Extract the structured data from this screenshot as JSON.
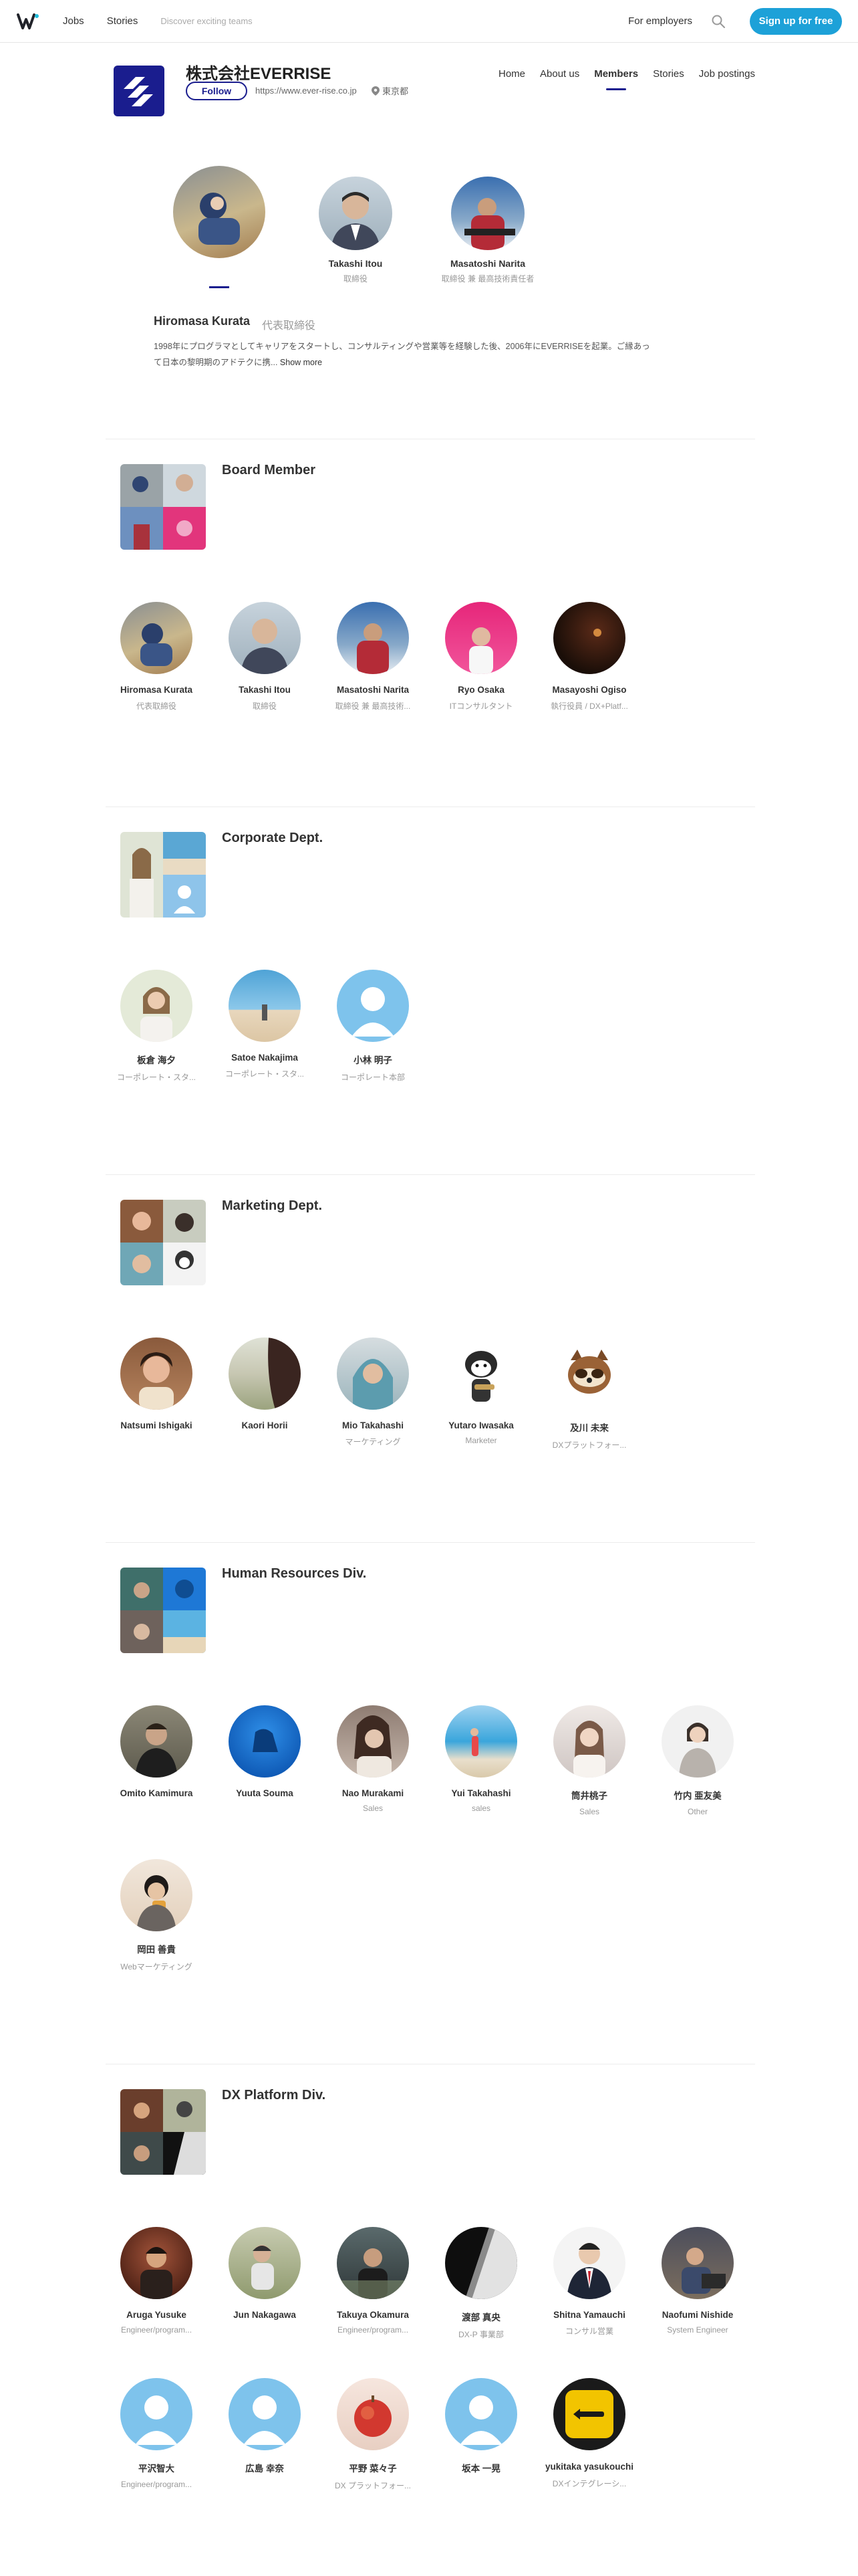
{
  "header": {
    "logo": "wantedly-w-logo",
    "nav_jobs": "Jobs",
    "nav_stories": "Stories",
    "nav_hint": "Discover exciting teams",
    "for_employers": "For employers",
    "signup": "Sign up for free",
    "accent": "#1da1d8"
  },
  "company": {
    "name": "株式会社EVERRISE",
    "follow": "Follow",
    "url": "https://www.ever-rise.co.jp",
    "location": "東京都",
    "brand_color": "#1a1d8e",
    "tabs": [
      {
        "label": "Home"
      },
      {
        "label": "About us"
      },
      {
        "label": "Members",
        "active": true
      },
      {
        "label": "Stories"
      },
      {
        "label": "Job postings"
      }
    ]
  },
  "featured": {
    "members": [
      {
        "name": "",
        "role": ""
      },
      {
        "name": "Takashi Itou",
        "role": "取締役"
      },
      {
        "name": "Masatoshi Narita",
        "role": "取締役 兼 最高技術責任者"
      }
    ],
    "profile_name": "Hiromasa Kurata",
    "profile_role": "代表取締役",
    "bio_line1": "1998年にプログラマとしてキャリアをスタートし、コンサルティングや営業等を経験した後、2006年にEVERRISEを起業。ご縁あっ",
    "bio_line2": "て日本の黎明期のアドテクに携...",
    "show_more": "Show more"
  },
  "groups": [
    {
      "title": "Board Member",
      "members": [
        {
          "name": "Hiromasa Kurata",
          "role": "代表取締役"
        },
        {
          "name": "Takashi Itou",
          "role": "取締役"
        },
        {
          "name": "Masatoshi Narita",
          "role": "取締役 兼 最高技術..."
        },
        {
          "name": "Ryo Osaka",
          "role": "ITコンサルタント"
        },
        {
          "name": "Masayoshi Ogiso",
          "role": "執行役員 / DX+Platf..."
        }
      ]
    },
    {
      "title": "Corporate Dept.",
      "members": [
        {
          "name": "板倉 海夕",
          "role": "コーポレート・スタ..."
        },
        {
          "name": "Satoe Nakajima",
          "role": "コーポレート・スタ..."
        },
        {
          "name": "小林 明子",
          "role": "コーポレート本部"
        }
      ]
    },
    {
      "title": "Marketing Dept.",
      "members": [
        {
          "name": "Natsumi Ishigaki",
          "role": ""
        },
        {
          "name": "Kaori Horii",
          "role": ""
        },
        {
          "name": "Mio Takahashi",
          "role": "マーケティング"
        },
        {
          "name": "Yutaro Iwasaka",
          "role": "Marketer"
        },
        {
          "name": "及川 未来",
          "role": "DXプラットフォー..."
        }
      ]
    },
    {
      "title": "Human Resources Div.",
      "members": [
        {
          "name": "Omito Kamimura",
          "role": ""
        },
        {
          "name": "Yuuta Souma",
          "role": ""
        },
        {
          "name": "Nao Murakami",
          "role": "Sales"
        },
        {
          "name": "Yui Takahashi",
          "role": "sales"
        },
        {
          "name": "筒井桃子",
          "role": "Sales"
        },
        {
          "name": "竹内 亜友美",
          "role": "Other"
        },
        {
          "name": "岡田 善貴",
          "role": "Webマーケティング"
        }
      ]
    },
    {
      "title": "DX Platform Div.",
      "members": [
        {
          "name": "Aruga Yusuke",
          "role": "Engineer/program..."
        },
        {
          "name": "Jun Nakagawa",
          "role": ""
        },
        {
          "name": "Takuya Okamura",
          "role": "Engineer/program..."
        },
        {
          "name": "渡部 真央",
          "role": "DX-P 事業部"
        },
        {
          "name": "Shitna Yamauchi",
          "role": "コンサル営業"
        },
        {
          "name": "Naofumi Nishide",
          "role": "System Engineer"
        },
        {
          "name": "平沢智大",
          "role": "Engineer/program..."
        },
        {
          "name": "広島 幸奈",
          "role": ""
        },
        {
          "name": "平野 菜々子",
          "role": "DX プラットフォー..."
        },
        {
          "name": "坂本 一晃",
          "role": ""
        },
        {
          "name": "yukitaka yasukouchi",
          "role": "DXインテグレーシ..."
        }
      ]
    }
  ]
}
